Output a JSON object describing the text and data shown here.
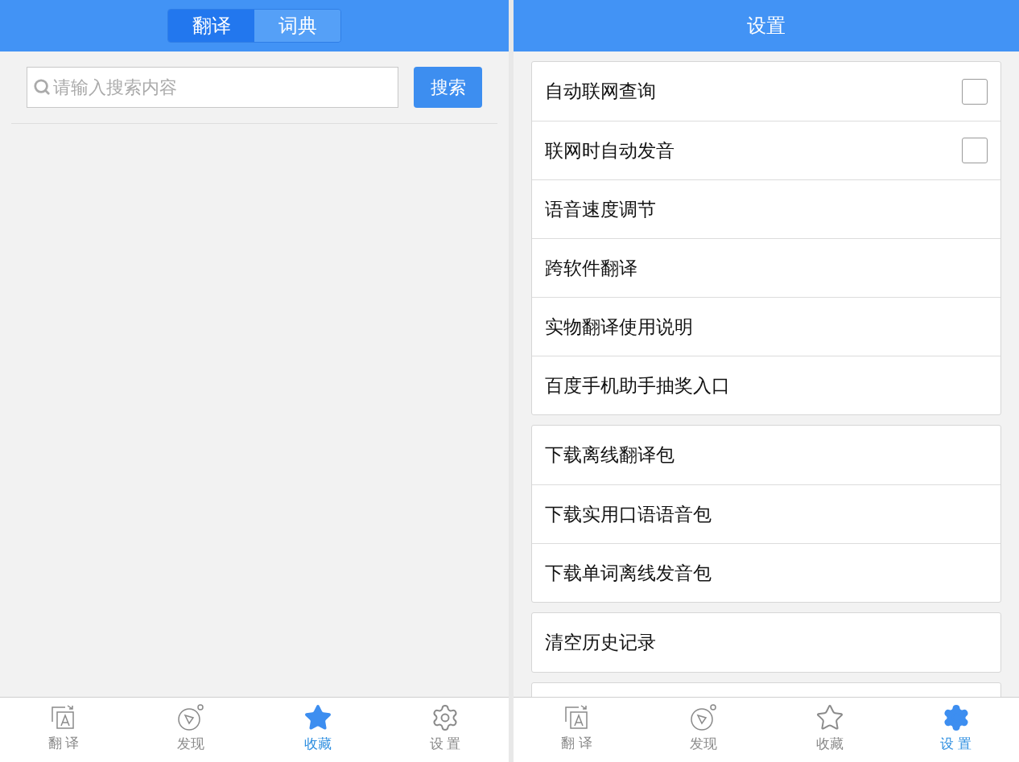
{
  "left_screen": {
    "segments": [
      {
        "label": "翻译",
        "selected": true
      },
      {
        "label": "词典",
        "selected": false
      }
    ],
    "search": {
      "placeholder": "请输入搜索内容",
      "button": "搜索"
    },
    "tab_bar": [
      {
        "kind": "translate",
        "label": "翻 译",
        "selected": false
      },
      {
        "kind": "discover",
        "label": "发现",
        "selected": false
      },
      {
        "kind": "favorites",
        "label": "收藏",
        "selected": true
      },
      {
        "kind": "settings",
        "label": "设 置",
        "selected": false
      }
    ]
  },
  "right_screen": {
    "title": "设置",
    "groups": [
      [
        {
          "kind": "checkbox",
          "label": "自动联网查询",
          "checked": false
        },
        {
          "kind": "checkbox",
          "label": "联网时自动发音",
          "checked": false
        },
        {
          "kind": "link",
          "label": "语音速度调节"
        },
        {
          "kind": "link",
          "label": "跨软件翻译"
        },
        {
          "kind": "link",
          "label": "实物翻译使用说明"
        },
        {
          "kind": "link",
          "label": "百度手机助手抽奖入口"
        }
      ],
      [
        {
          "kind": "link",
          "label": "下载离线翻译包"
        },
        {
          "kind": "link",
          "label": "下载实用口语语音包"
        },
        {
          "kind": "link",
          "label": "下载单词离线发音包"
        }
      ],
      [
        {
          "kind": "link",
          "label": "清空历史记录"
        }
      ]
    ],
    "tab_bar": [
      {
        "kind": "translate",
        "label": "翻 译",
        "selected": false
      },
      {
        "kind": "discover",
        "label": "发现",
        "selected": false
      },
      {
        "kind": "favorites",
        "label": "收藏",
        "selected": false
      },
      {
        "kind": "settings",
        "label": "设 置",
        "selected": true
      }
    ]
  }
}
